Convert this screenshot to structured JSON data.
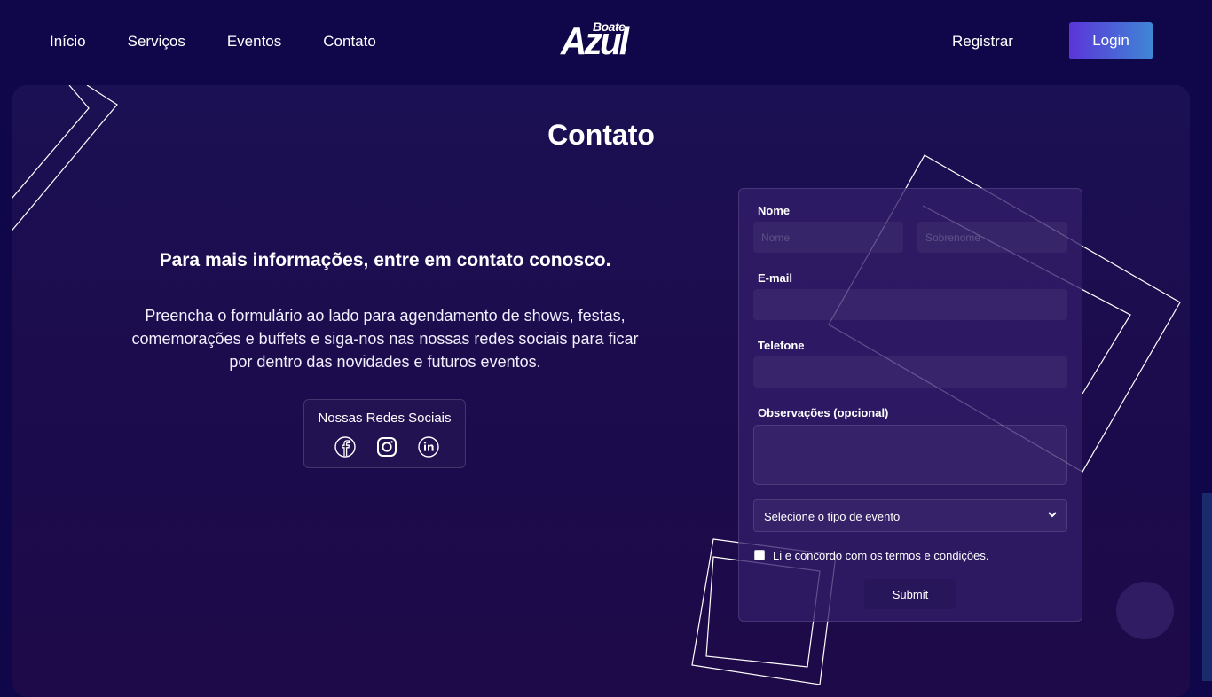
{
  "nav": {
    "links": [
      "Início",
      "Serviços",
      "Eventos",
      "Contato"
    ],
    "logo_small": "Boate",
    "logo_big": "Azul",
    "register_label": "Registrar",
    "login_label": "Login"
  },
  "page": {
    "title": "Contato",
    "info_heading": "Para mais informações, entre em contato conosco.",
    "info_text": "Preencha o formulário ao lado para agendamento de shows, festas, comemorações e buffets e siga-nos nas nossas redes sociais para ficar por dentro das novidades e futuros eventos."
  },
  "social": {
    "title": "Nossas Redes Sociais",
    "icons": [
      "facebook-icon",
      "instagram-icon",
      "linkedin-icon"
    ]
  },
  "form": {
    "name_label": "Nome",
    "first_name_placeholder": "Nome",
    "last_name_placeholder": "Sobrenome",
    "email_label": "E-mail",
    "phone_label": "Telefone",
    "notes_label": "Observações (opcional)",
    "event_type_selected": "Selecione o tipo de evento",
    "terms_label": "Li e concordo com os termos e condições.",
    "submit_label": "Submit"
  },
  "colors": {
    "background": "#10064a",
    "panel": "#1b1053",
    "login_gradient_start": "#5b35d8",
    "login_gradient_end": "#3f86d6"
  }
}
